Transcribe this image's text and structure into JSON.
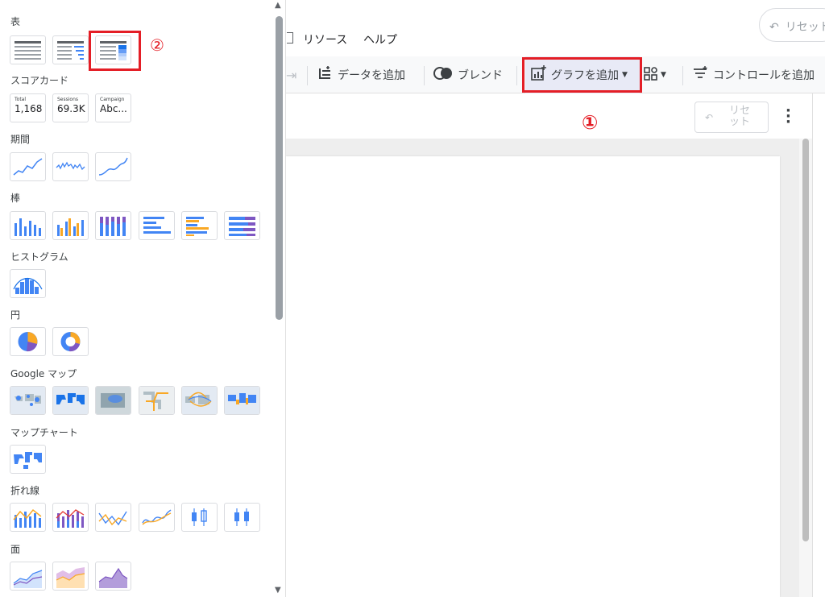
{
  "menubar": {
    "items": [
      "リソース",
      "ヘルプ"
    ],
    "reset_label": "リセット"
  },
  "toolbar": {
    "add_data": "データを追加",
    "blend": "ブレンド",
    "add_chart": "グラフを追加",
    "add_control": "コントロールを追加"
  },
  "canvas": {
    "reset_label": "リセット"
  },
  "annotations": {
    "one": "①",
    "two": "②",
    "color": "#e41e26"
  },
  "panel": {
    "sections": {
      "table": "表",
      "scorecard": "スコアカード",
      "timeseries": "期間",
      "bar": "棒",
      "histogram": "ヒストグラム",
      "pie": "円",
      "google_maps": "Google マップ",
      "map_chart": "マップチャート",
      "line": "折れ線",
      "area": "面"
    },
    "scorecards": [
      {
        "label": "Total",
        "value": "1,168"
      },
      {
        "label": "Sessions",
        "value": "69.3K"
      },
      {
        "label": "Campaign",
        "value": "Abc..."
      }
    ]
  },
  "colors": {
    "blue": "#4285f4",
    "orange": "#f9a825",
    "purple": "#7e57c2",
    "highlight": "#e41e26"
  }
}
